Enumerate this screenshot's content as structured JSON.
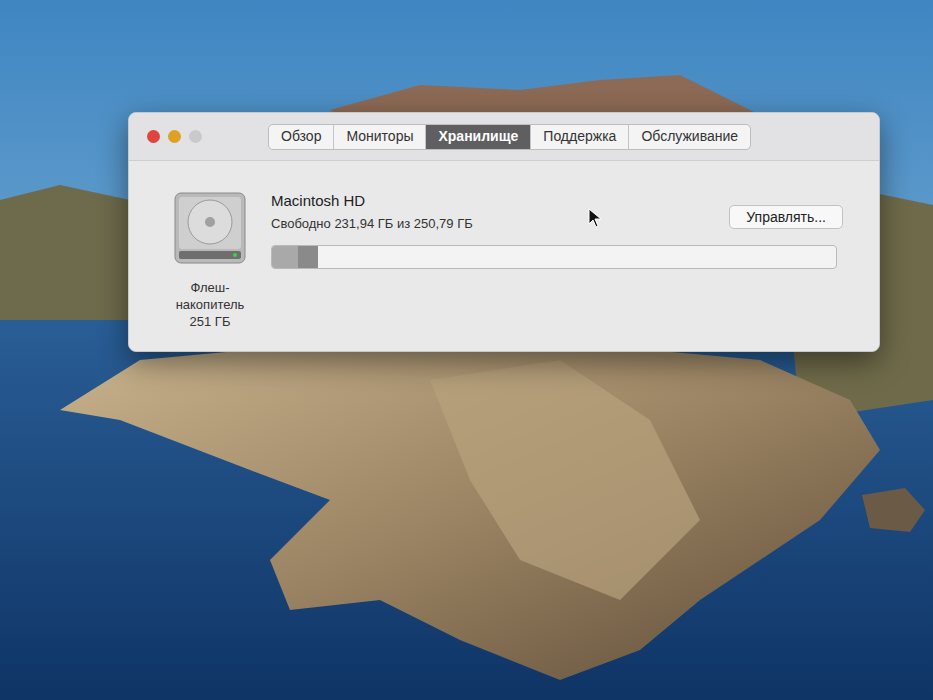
{
  "tabs": [
    {
      "label": "Обзор",
      "selected": false
    },
    {
      "label": "Мониторы",
      "selected": false
    },
    {
      "label": "Хранилище",
      "selected": true
    },
    {
      "label": "Поддержка",
      "selected": false
    },
    {
      "label": "Обслуживание",
      "selected": false
    }
  ],
  "disk": {
    "name": "Macintosh HD",
    "free": "Свободно 231,94 ГБ из 250,79 ГБ",
    "kind": "Флеш-накопитель",
    "capacity": "251 ГБ"
  },
  "storage_bar": {
    "segments": [
      {
        "level": 0.046,
        "color": "#a9a9a9"
      },
      {
        "level": 0.036,
        "color": "#8a8a8a"
      }
    ]
  },
  "buttons": [
    "Управлять..."
  ]
}
